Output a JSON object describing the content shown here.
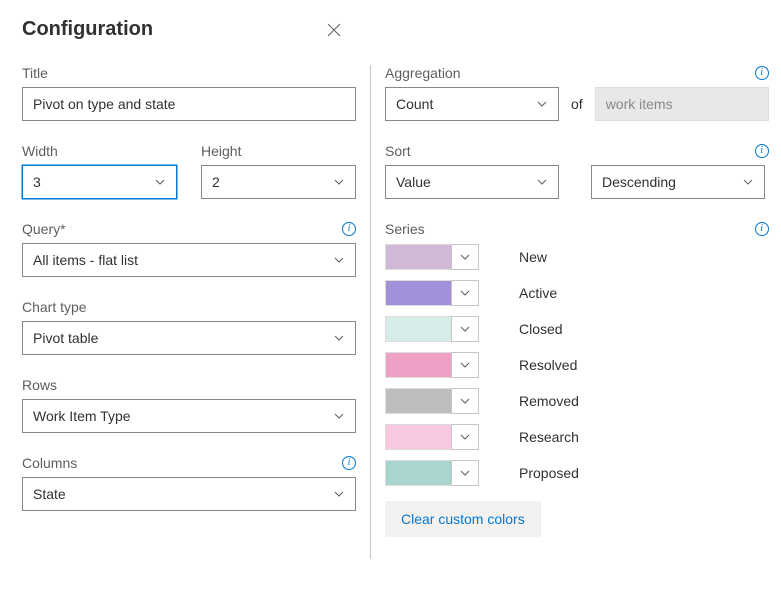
{
  "header": {
    "title": "Configuration"
  },
  "left": {
    "title_label": "Title",
    "title_value": "Pivot on type and state",
    "width_label": "Width",
    "width_value": "3",
    "height_label": "Height",
    "height_value": "2",
    "query_label": "Query*",
    "query_value": "All items - flat list",
    "charttype_label": "Chart type",
    "charttype_value": "Pivot table",
    "rows_label": "Rows",
    "rows_value": "Work Item Type",
    "columns_label": "Columns",
    "columns_value": "State"
  },
  "right": {
    "aggregation_label": "Aggregation",
    "aggregation_value": "Count",
    "of_word": "of",
    "of_target": "work items",
    "sort_label": "Sort",
    "sort_field": "Value",
    "sort_dir": "Descending",
    "series_label": "Series",
    "series": [
      {
        "label": "New",
        "color": "#d0b9d6"
      },
      {
        "label": "Active",
        "color": "#a18fd8"
      },
      {
        "label": "Closed",
        "color": "#d5ece9"
      },
      {
        "label": "Resolved",
        "color": "#efa0c6"
      },
      {
        "label": "Removed",
        "color": "#bdbdbd"
      },
      {
        "label": "Research",
        "color": "#f7c8df"
      },
      {
        "label": "Proposed",
        "color": "#a8d6cf"
      }
    ],
    "clear_colors": "Clear custom colors"
  }
}
